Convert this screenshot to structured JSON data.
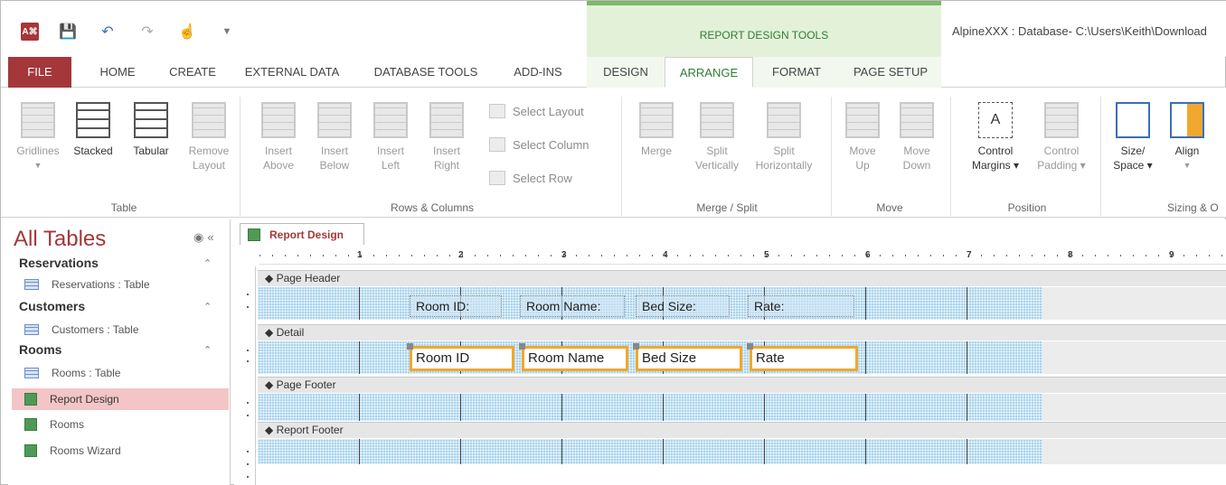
{
  "window": {
    "title": "AlpineXXX : Database- C:\\Users\\Keith\\Download",
    "context_group": "REPORT DESIGN TOOLS",
    "app_logo": "A⌘",
    "quick_access": [
      "save-icon",
      "undo-icon",
      "redo-icon",
      "touch-mode-icon",
      "customize-icon"
    ]
  },
  "tabs": [
    "FILE",
    "HOME",
    "CREATE",
    "EXTERNAL DATA",
    "DATABASE TOOLS",
    "ADD-INS",
    "DESIGN",
    "ARRANGE",
    "FORMAT",
    "PAGE SETUP"
  ],
  "active_tab": "ARRANGE",
  "ribbon": {
    "table": {
      "label": "Table",
      "gridlines": "Gridlines",
      "stacked": "Stacked",
      "tabular": "Tabular",
      "remove1": "Remove",
      "remove2": "Layout"
    },
    "rows_columns": {
      "label": "Rows & Columns",
      "insert_above1": "Insert",
      "insert_above2": "Above",
      "insert_below1": "Insert",
      "insert_below2": "Below",
      "insert_left1": "Insert",
      "insert_left2": "Left",
      "insert_right1": "Insert",
      "insert_right2": "Right",
      "select_layout": "Select Layout",
      "select_column": "Select Column",
      "select_row": "Select Row"
    },
    "merge_split": {
      "label": "Merge / Split",
      "merge": "Merge",
      "split_v1": "Split",
      "split_v2": "Vertically",
      "split_h1": "Split",
      "split_h2": "Horizontally"
    },
    "move": {
      "label": "Move",
      "up1": "Move",
      "up2": "Up",
      "down1": "Move",
      "down2": "Down"
    },
    "position": {
      "label": "Position",
      "cm1": "Control",
      "cm2": "Margins ▾",
      "cp1": "Control",
      "cp2": "Padding ▾"
    },
    "sizing": {
      "label": "Sizing & O",
      "size1": "Size/",
      "size2": "Space ▾",
      "align": "Align"
    }
  },
  "nav": {
    "title": "All Tables",
    "groups": [
      {
        "name": "Reservations",
        "items": [
          "Reservations : Table"
        ]
      },
      {
        "name": "Customers",
        "items": [
          "Customers : Table"
        ]
      },
      {
        "name": "Rooms",
        "items": [
          "Rooms : Table",
          "Report Design",
          "Rooms",
          "Rooms Wizard"
        ]
      }
    ],
    "selected": "Report Design"
  },
  "document": {
    "tab_label": "Report Design",
    "ruler_marks": [
      "1",
      "2",
      "3",
      "4",
      "5",
      "6",
      "7",
      "8",
      "9"
    ],
    "sections": {
      "page_header": "◆ Page Header",
      "detail": "◆ Detail",
      "page_footer": "◆ Page Footer",
      "report_footer": "◆ Report Footer"
    },
    "header_labels": [
      "Room ID:",
      "Room Name:",
      "Bed Size:",
      "Rate:"
    ],
    "detail_fields": [
      "Room ID",
      "Room Name",
      "Bed Size",
      "Rate"
    ]
  },
  "colors": {
    "access_red": "#a4373a",
    "context_green": "#2f7d32",
    "selection_orange": "#f0a830",
    "band_blue": "#a9d3ee"
  }
}
